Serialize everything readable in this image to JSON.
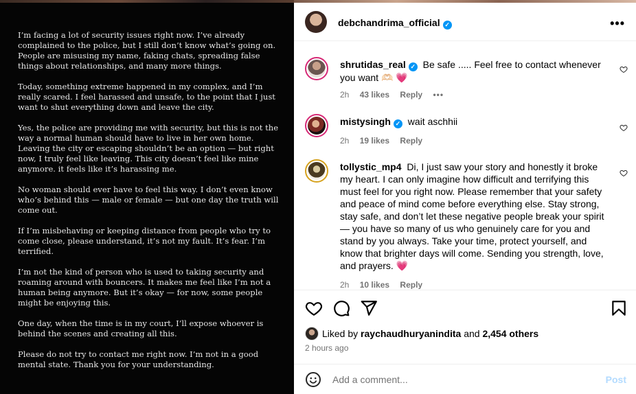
{
  "post_image": {
    "paragraphs": [
      "I’m facing a lot of security issues right now. I’ve already complained to the police, but I still don’t know what’s going on. People are misusing my name, faking chats, spreading false things about relationships, and many more things.",
      "Today, something extreme happened in my complex, and I’m really scared. I feel harassed and unsafe, to the point that I just want to shut everything down and leave the city.",
      "Yes, the police are providing me with security, but this is not the way a normal human should have to live in her own home. Leaving the city or escaping shouldn’t be an option — but right now, I truly feel like leaving. This city doesn’t feel like mine anymore. it feels like it’s harassing me.",
      "No woman should ever have to feel this way. I don’t even know who’s behind this — male or female — but one day the truth will come out.",
      "If I’m misbehaving or keeping distance from people who try to come close, please understand, it’s not my fault. It’s fear. I’m terrified.",
      "I’m not the kind of person who is used to taking security and roaming around with bouncers. It makes me feel like I’m not a human being anymore. But it’s okay — for now, some people might be enjoying this.",
      "One day, when the time is in my court, I’ll expose whoever is behind the scenes and creating all this.",
      "Please do not try to contact me right now. I’m not in a good mental state. Thank you for your understanding."
    ]
  },
  "header": {
    "username": "debchandrima_official",
    "verified_mark": "✓",
    "more_icon": "more-horizontal-icon",
    "more_glyph": "•••"
  },
  "comments": [
    {
      "username": "shrutidas_real",
      "verified": true,
      "text": "Be safe ..... Feel free to contact whenever you want",
      "emoji": "🫶🏻 💗",
      "time": "2h",
      "likes": "43 likes",
      "reply": "Reply",
      "more": "•••"
    },
    {
      "username": "mistysingh",
      "verified": true,
      "text": "wait aschhii",
      "time": "2h",
      "likes": "19 likes",
      "reply": "Reply"
    },
    {
      "username": "tollystic_mp4",
      "verified": false,
      "text": "Di, I just saw your story and honestly it broke my heart. I can only imagine how difficult and terrifying this must feel for you right now. Please remember that your safety and peace of mind come before everything else. Stay strong, stay safe, and don’t let these negative people break your spirit — you have so many of us who genuinely care for you and stand by you always. Take your time, protect yourself, and know that brighter days will come. Sending you strength, love, and prayers.",
      "emoji": "💗",
      "time": "2h",
      "likes": "10 likes",
      "reply": "Reply"
    }
  ],
  "actions": {
    "icons": [
      "heart-icon",
      "comment-icon",
      "share-icon",
      "bookmark-icon"
    ]
  },
  "likes": {
    "prefix": "Liked by",
    "user": "raychaudhuryanindita",
    "joiner": "and",
    "others": "2,454 others"
  },
  "time_ago": "2 hours ago",
  "add_comment": {
    "placeholder": "Add a comment...",
    "post_label": "Post"
  },
  "colors": {
    "accent": "#0095f6",
    "post_disabled": "#b3dbff",
    "muted": "#737373",
    "image_bg": "#050505"
  }
}
